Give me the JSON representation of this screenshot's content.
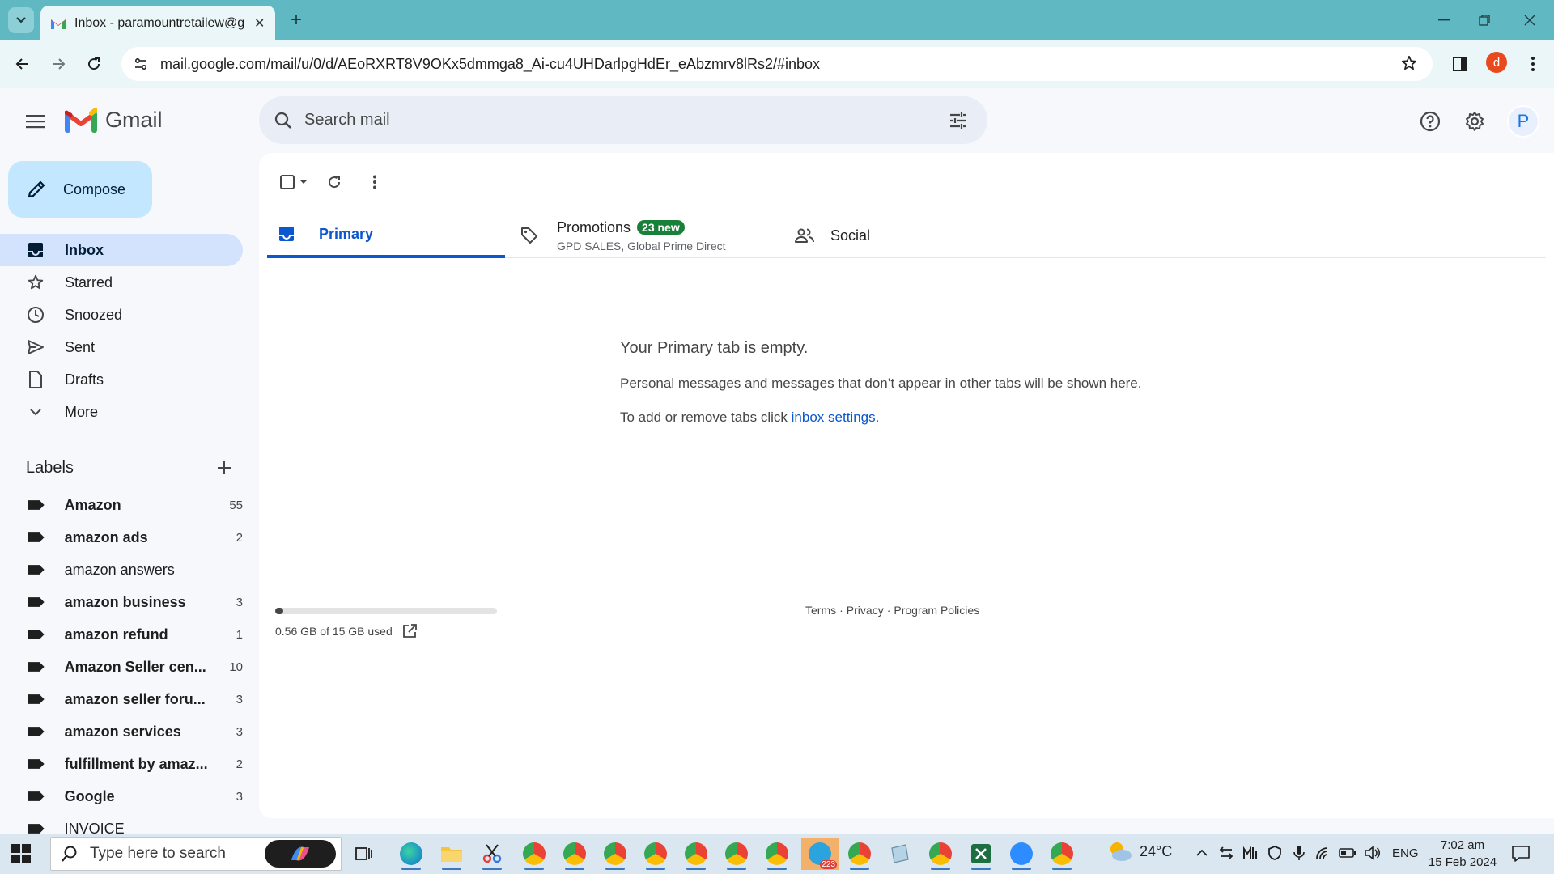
{
  "browser": {
    "tab_title": "Inbox - paramountretailew@gm",
    "url": "mail.google.com/mail/u/0/d/AEoRXRT8V9OKx5dmmga8_Ai-cu4UHDarlpgHdEr_eAbzmrv8lRs2/#inbox",
    "profile_initial": "d"
  },
  "gmail": {
    "logo_text": "Gmail",
    "search_placeholder": "Search mail",
    "account_initial": "P"
  },
  "sidebar": {
    "compose_label": "Compose",
    "items": [
      {
        "label": "Inbox",
        "icon": "inbox-icon",
        "active": true
      },
      {
        "label": "Starred",
        "icon": "star-icon"
      },
      {
        "label": "Snoozed",
        "icon": "clock-icon"
      },
      {
        "label": "Sent",
        "icon": "send-icon"
      },
      {
        "label": "Drafts",
        "icon": "draft-icon"
      },
      {
        "label": "More",
        "icon": "chevron-down-icon"
      }
    ],
    "labels_title": "Labels",
    "labels": [
      {
        "name": "Amazon",
        "count": "55",
        "bold": true
      },
      {
        "name": "amazon ads",
        "count": "2",
        "bold": true
      },
      {
        "name": "amazon answers",
        "count": "",
        "bold": false
      },
      {
        "name": "amazon business",
        "count": "3",
        "bold": true
      },
      {
        "name": "amazon refund",
        "count": "1",
        "bold": true
      },
      {
        "name": "Amazon Seller cen...",
        "count": "10",
        "bold": true
      },
      {
        "name": "amazon seller foru...",
        "count": "3",
        "bold": true
      },
      {
        "name": "amazon services",
        "count": "3",
        "bold": true
      },
      {
        "name": "fulfillment by amaz...",
        "count": "2",
        "bold": true
      },
      {
        "name": "Google",
        "count": "3",
        "bold": true
      },
      {
        "name": "INVOICE",
        "count": "",
        "bold": false
      }
    ]
  },
  "tabs": {
    "primary": "Primary",
    "promotions": "Promotions",
    "promotions_badge": "23 new",
    "promotions_senders": "GPD SALES, Global Prime Direct",
    "social": "Social"
  },
  "empty_state": {
    "title": "Your Primary tab is empty.",
    "line1": "Personal messages and messages that don’t appear in other tabs will be shown here.",
    "line2_prefix": "To add or remove tabs click ",
    "line2_link": "inbox settings",
    "line2_suffix": "."
  },
  "storage": {
    "text": "0.56 GB of 15 GB used",
    "used_fraction": 0.037
  },
  "footer": {
    "terms": "Terms",
    "privacy": "Privacy",
    "policies": "Program Policies",
    "sep": "·"
  },
  "taskbar": {
    "search_placeholder": "Type here to search",
    "telegram_badge": "223",
    "temperature": "24°C",
    "language": "ENG",
    "time": "7:02 am",
    "date": "15 Feb 2024"
  },
  "colors": {
    "tabstrip": "#5fb8c2",
    "active_tab": "#0b57d0",
    "compose_bg": "#c2e7ff",
    "promo_badge": "#188038"
  }
}
